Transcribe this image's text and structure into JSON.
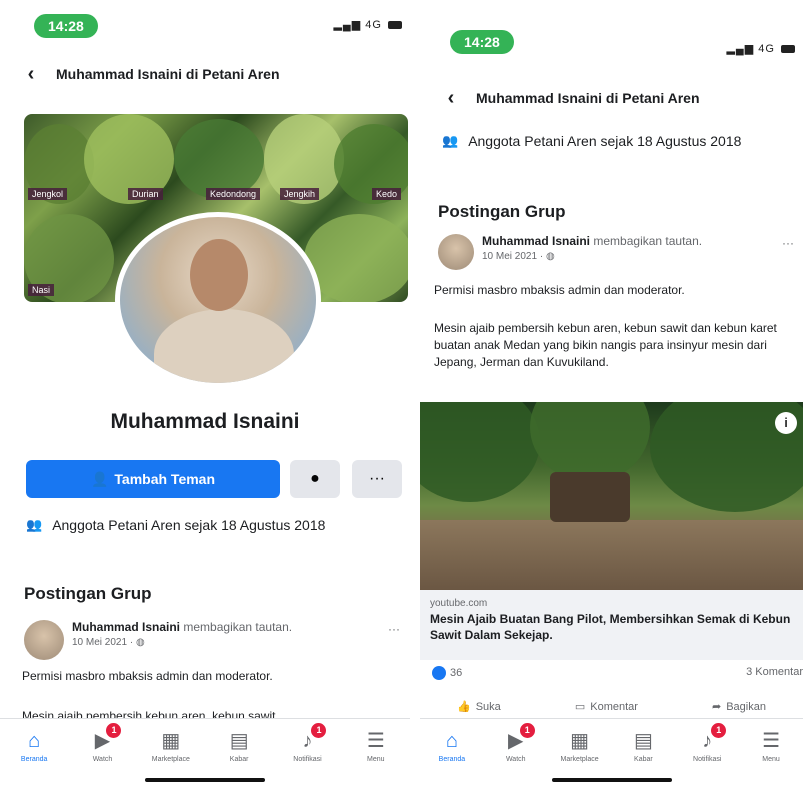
{
  "status": {
    "time": "14:28",
    "network": "4G"
  },
  "header": {
    "title": "Muhammad Isnaini di Petani Aren"
  },
  "cover": {
    "tags": [
      "Jengkol",
      "Durian",
      "Kedondong",
      "Jengkih",
      "Nasi",
      "Kedo"
    ]
  },
  "profile": {
    "name": "Muhammad Isnaini",
    "add_friend_label": "Tambah Teman",
    "more_label": "···",
    "member_text": "Anggota Petani Aren sejak 18 Agustus 2018"
  },
  "section": {
    "title": "Postingan Grup"
  },
  "post": {
    "author": "Muhammad Isnaini",
    "action": "membagikan tautan.",
    "date": "10 Mei 2021 · ",
    "dots": "···",
    "line1": "Permisi masbro mbaksis admin dan moderator.",
    "line2": "Mesin ajaib pembersih kebun aren, kebun sawit dan kebun karet buatan anak Medan yang bikin nangis para insinyur mesin dari Jepang, Jerman dan Kuvukiland.",
    "line2_cut": "Mesin ajaib pembersih kebun aren, kebun sawit",
    "link_domain": "youtube.com",
    "link_title": "Mesin Ajaib Buatan Bang Pilot, Membersihkan Semak di Kebun Sawit Dalam Sekejap.",
    "likes": "36",
    "comments": "3 Komentar"
  },
  "actions": {
    "like": "Suka",
    "comment": "Komentar",
    "share": "Bagikan"
  },
  "tabs": [
    {
      "label": "Beranda",
      "icon": "home-icon",
      "badge": ""
    },
    {
      "label": "Watch",
      "icon": "watch-icon",
      "badge": "1"
    },
    {
      "label": "Marketplace",
      "icon": "marketplace-icon",
      "badge": ""
    },
    {
      "label": "Kabar",
      "icon": "news-icon",
      "badge": ""
    },
    {
      "label": "Notifikasi",
      "icon": "bell-icon",
      "badge": "1"
    },
    {
      "label": "Menu",
      "icon": "menu-icon",
      "badge": ""
    }
  ],
  "colors": {
    "accent": "#1877f2",
    "badge": "#e41e3f",
    "time_pill": "#34b356"
  }
}
